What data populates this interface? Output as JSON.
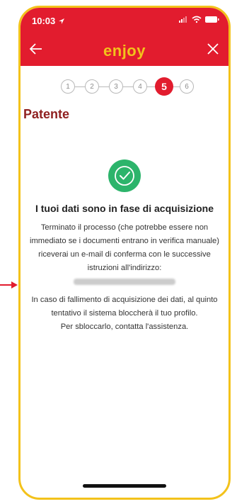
{
  "status_bar": {
    "time": "10:03"
  },
  "header": {
    "logo": "enjoy"
  },
  "stepper": {
    "steps": [
      "1",
      "2",
      "3",
      "4",
      "5",
      "6"
    ],
    "active": "5"
  },
  "section": {
    "title": "Patente"
  },
  "message": {
    "title": "I tuoi dati sono in fase di acquisizione",
    "line1": "Terminato il processo (che potrebbe essere non immediato se i documenti entrano in verifica manuale) riceverai un e-mail di conferma con le successive istruzioni all'indirizzo:",
    "line2": "In caso di fallimento di acquisizione dei dati, al quinto tentativo il sistema bloccherà il tuo profilo.",
    "line3": "Per sbloccarlo, contatta l'assistenza."
  },
  "colors": {
    "brand_red": "#e21c2e",
    "accent_yellow": "#f3c21b",
    "success_green": "#2cb46b",
    "title_red": "#8f1f1f"
  },
  "icons": [
    "location-arrow-icon",
    "signal-icon",
    "wifi-icon",
    "battery-icon",
    "back-arrow-icon",
    "close-icon",
    "success-check-icon"
  ]
}
